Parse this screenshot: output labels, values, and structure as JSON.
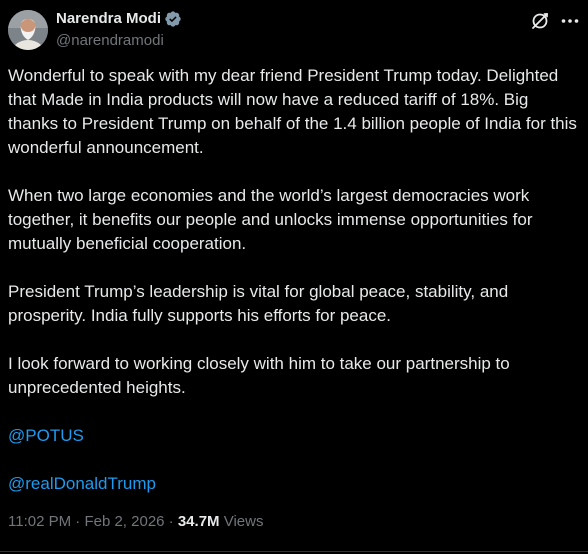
{
  "author": {
    "display_name": "Narendra Modi",
    "handle": "@narendramodi",
    "verified_icon": "verified-badge-icon",
    "avatar_icon": "profile-avatar"
  },
  "header_actions": {
    "grok_icon": "grok-icon",
    "more_icon": "more-options-icon"
  },
  "post": {
    "paragraphs": [
      "Wonderful to speak with my dear friend President Trump today. Delighted that Made in India products will now have a reduced tariff of 18%. Big thanks to President Trump on behalf of the 1.4 billion people of India for this wonderful announcement.",
      "When two large economies and the world’s largest democracies work together, it benefits our people and unlocks immense opportunities for mutually beneficial cooperation.",
      "President Trump’s leadership is vital for global peace, stability, and prosperity. India fully supports his efforts for peace.",
      "I look forward to working closely with him to take our partnership to unprecedented heights."
    ],
    "mentions": [
      "@POTUS",
      "@realDonaldTrump"
    ]
  },
  "meta": {
    "time": "11:02 PM",
    "separator": " · ",
    "date": "Feb 2, 2026",
    "views_count": "34.7M",
    "views_label": "Views"
  },
  "colors": {
    "background": "#000000",
    "text": "#e7e9ea",
    "secondary": "#71767b",
    "link": "#1d9bf0",
    "verified": "#829aab"
  }
}
